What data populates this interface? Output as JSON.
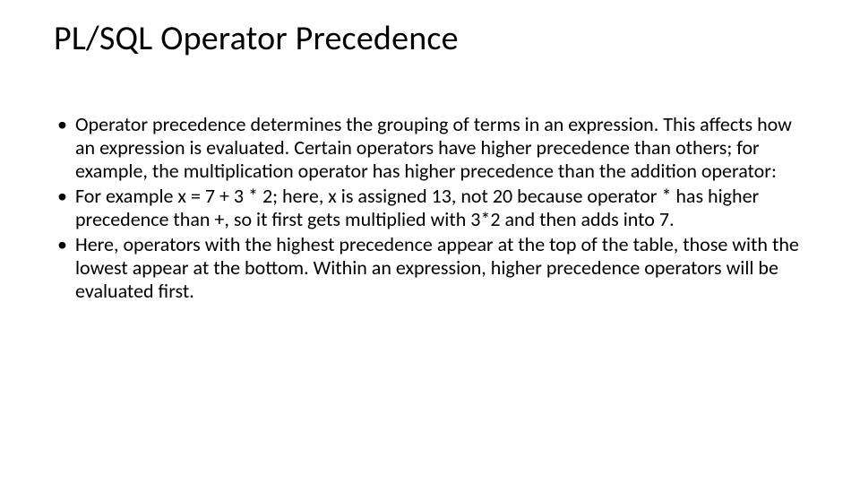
{
  "slide": {
    "title": "PL/SQL Operator Precedence",
    "bullets": [
      "Operator precedence determines the grouping of terms in an expression. This affects how an expression is evaluated. Certain operators have higher precedence than others; for example, the multiplication operator has higher precedence than the addition operator:",
      "For example x = 7 + 3 * 2; here, x is assigned 13, not 20 because operator * has higher precedence than +, so it first gets multiplied with 3*2 and then adds into 7.",
      "Here, operators with the highest precedence appear at the top of the table, those with the lowest appear at the bottom. Within an expression, higher precedence operators will be evaluated first."
    ]
  }
}
